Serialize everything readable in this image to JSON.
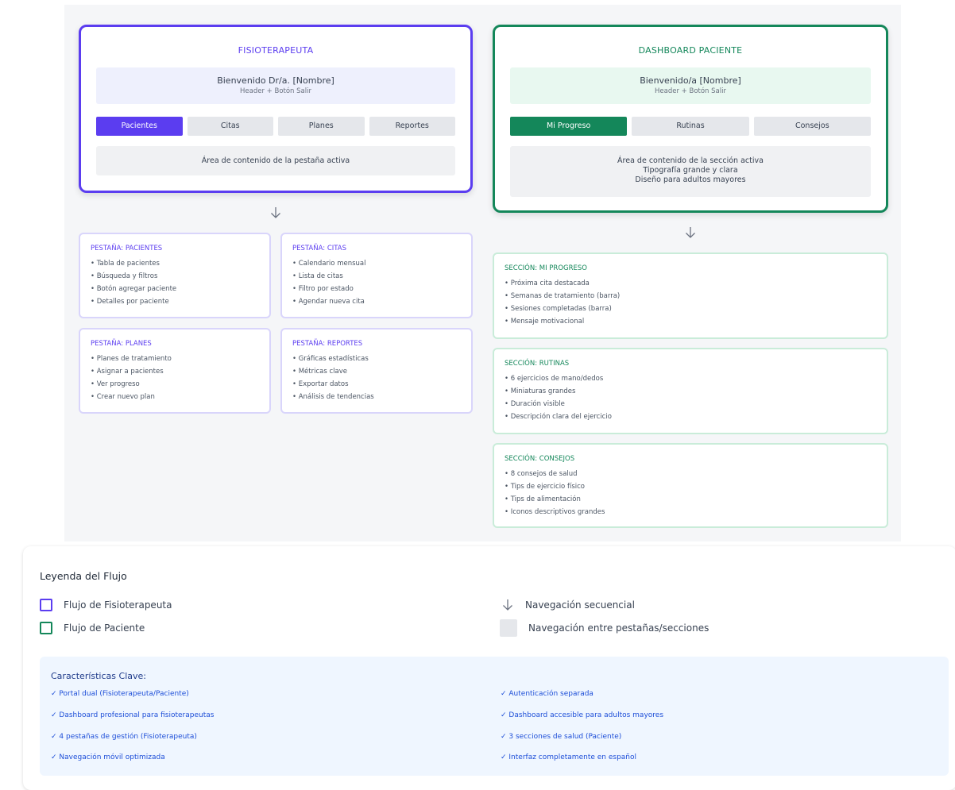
{
  "physio": {
    "title": "FISIOTERAPEUTA",
    "header_line1": "Bienvenido Dr/a. [Nombre]",
    "header_line2": "Header + Botón Salir",
    "tabs": [
      "Pacientes",
      "Citas",
      "Planes",
      "Reportes"
    ],
    "content": "Área de contenido de la pestaña activa",
    "cards": [
      {
        "title": "PESTAÑA: PACIENTES",
        "items": [
          "• Tabla de pacientes",
          "• Búsqueda y filtros",
          "• Botón agregar paciente",
          "• Detalles por paciente"
        ]
      },
      {
        "title": "PESTAÑA: CITAS",
        "items": [
          "• Calendario mensual",
          "• Lista de citas",
          "• Filtro por estado",
          "• Agendar nueva cita"
        ]
      },
      {
        "title": "PESTAÑA: PLANES",
        "items": [
          "• Planes de tratamiento",
          "• Asignar a pacientes",
          "• Ver progreso",
          "• Crear nuevo plan"
        ]
      },
      {
        "title": "PESTAÑA: REPORTES",
        "items": [
          "• Gráficas estadísticas",
          "• Métricas clave",
          "• Exportar datos",
          "• Análisis de tendencias"
        ]
      }
    ]
  },
  "patient": {
    "title": "DASHBOARD PACIENTE",
    "header_line1": "Bienvenido/a [Nombre]",
    "header_line2": "Header + Botón Salir",
    "tabs": [
      "Mi Progreso",
      "Rutinas",
      "Consejos"
    ],
    "content": [
      "Área de contenido de la sección activa",
      "Tipografía grande y clara",
      "Diseño para adultos mayores"
    ],
    "cards": [
      {
        "title": "SECCIÓN: MI PROGRESO",
        "items": [
          "• Próxima cita destacada",
          "• Semanas de tratamiento (barra)",
          "• Sesiones completadas (barra)",
          "• Mensaje motivacional"
        ]
      },
      {
        "title": "SECCIÓN: RUTINAS",
        "items": [
          "• 6 ejercicios de mano/dedos",
          "• Miniaturas grandes",
          "• Duración visible",
          "• Descripción clara del ejercicio"
        ]
      },
      {
        "title": "SECCIÓN: CONSEJOS",
        "items": [
          "• 8 consejos de salud",
          "• Tips de ejercicio físico",
          "• Tips de alimentación",
          "• Iconos descriptivos grandes"
        ]
      }
    ]
  },
  "legend": {
    "title": "Leyenda del Flujo",
    "items": [
      "Flujo de Fisioterapeuta",
      "Flujo de Paciente",
      "Navegación secuencial",
      "Navegación entre pestañas/secciones"
    ],
    "features_title": "Características Clave:",
    "features_left": [
      "✓ Portal dual (Fisioterapeuta/Paciente)",
      "✓ Dashboard profesional para fisioterapeutas",
      "✓ 4 pestañas de gestión (Fisioterapeuta)",
      "✓ Navegación móvil optimizada"
    ],
    "features_right": [
      "✓ Autenticación separada",
      "✓ Dashboard accesible para adultos mayores",
      "✓ 3 secciones de salud (Paciente)",
      "✓ Interfaz completamente en español"
    ]
  },
  "colors": {
    "physio": "#5b3df0",
    "patient": "#14875a",
    "tab_inactive": "#e5e7eb",
    "feature_text": "#1d4ed8"
  },
  "icons": {
    "arrow": "arrow-down-icon"
  }
}
